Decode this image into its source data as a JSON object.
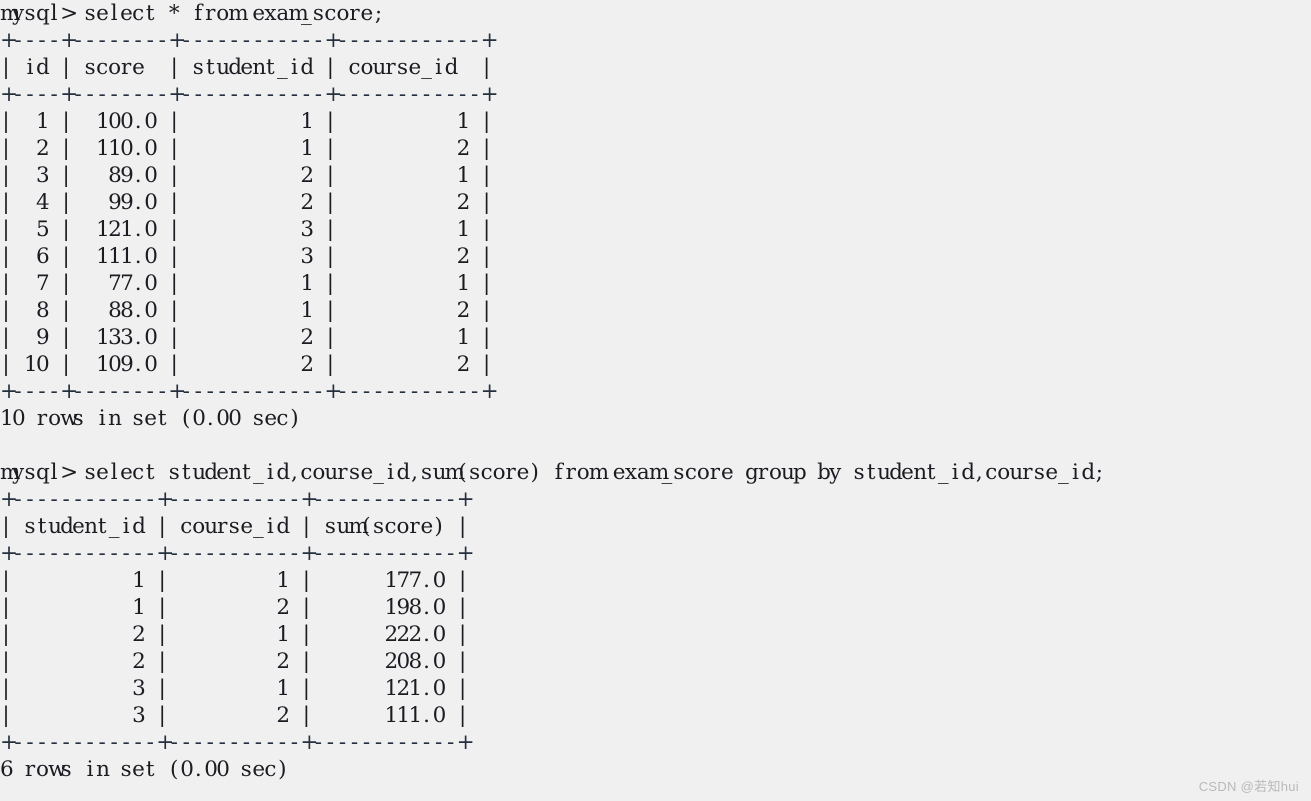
{
  "theme": {
    "background": "#f0f0f0",
    "foreground": "#1b1b22",
    "rule_color": "#25303f",
    "watermark_color": "#b9b9b9"
  },
  "terminal": {
    "prompt": "mysql>",
    "blocks": [
      {
        "type": "command",
        "name": "query-1",
        "text": "mysql> select * from exam_score;"
      },
      {
        "type": "table",
        "name": "result-table-1",
        "top_rule": "+----+--------+------------+------------+",
        "header_row": "| id | score  | student_id | course_id  |",
        "header_rule": "+----+--------+------------+------------+",
        "columns": [
          "id",
          "score",
          "student_id",
          "course_id"
        ],
        "rows": [
          [
            "1",
            "100.0",
            "1",
            "1"
          ],
          [
            "2",
            "110.0",
            "1",
            "2"
          ],
          [
            "3",
            "89.0",
            "2",
            "1"
          ],
          [
            "4",
            "99.0",
            "2",
            "2"
          ],
          [
            "5",
            "121.0",
            "3",
            "1"
          ],
          [
            "6",
            "111.0",
            "3",
            "2"
          ],
          [
            "7",
            "77.0",
            "1",
            "1"
          ],
          [
            "8",
            "88.0",
            "1",
            "2"
          ],
          [
            "9",
            "133.0",
            "2",
            "1"
          ],
          [
            "10",
            "109.0",
            "2",
            "2"
          ]
        ],
        "row_lines": [
          "|  1 |  100.0 |          1 |          1 |",
          "|  2 |  110.0 |          1 |          2 |",
          "|  3 |   89.0 |          2 |          1 |",
          "|  4 |   99.0 |          2 |          2 |",
          "|  5 |  121.0 |          3 |          1 |",
          "|  6 |  111.0 |          3 |          2 |",
          "|  7 |   77.0 |          1 |          1 |",
          "|  8 |   88.0 |          1 |          2 |",
          "|  9 |  133.0 |          2 |          1 |",
          "| 10 |  109.0 |          2 |          2 |"
        ],
        "bottom_rule": "+----+--------+------------+------------+"
      },
      {
        "type": "status",
        "name": "status-1",
        "text": "10 rows in set (0.00 sec)"
      },
      {
        "type": "blank",
        "name": "spacer-1",
        "text": ""
      },
      {
        "type": "command",
        "name": "query-2",
        "text": "mysql> select student_id,course_id,sum(score) from exam_score group by student_id,course_id;"
      },
      {
        "type": "table",
        "name": "result-table-2",
        "top_rule": "+------------+-----------+------------+",
        "header_row": "| student_id | course_id | sum(score) |",
        "header_rule": "+------------+-----------+------------+",
        "columns": [
          "student_id",
          "course_id",
          "sum(score)"
        ],
        "rows": [
          [
            "1",
            "1",
            "177.0"
          ],
          [
            "1",
            "2",
            "198.0"
          ],
          [
            "2",
            "1",
            "222.0"
          ],
          [
            "2",
            "2",
            "208.0"
          ],
          [
            "3",
            "1",
            "121.0"
          ],
          [
            "3",
            "2",
            "111.0"
          ]
        ],
        "row_lines": [
          "|          1 |         1 |      177.0 |",
          "|          1 |         2 |      198.0 |",
          "|          2 |         1 |      222.0 |",
          "|          2 |         2 |      208.0 |",
          "|          3 |         1 |      121.0 |",
          "|          3 |         2 |      111.0 |"
        ],
        "bottom_rule": "+------------+-----------+------------+"
      },
      {
        "type": "status",
        "name": "status-2",
        "text": "6 rows in set (0.00 sec)"
      }
    ]
  },
  "watermark": {
    "text": "CSDN @若知hui"
  }
}
